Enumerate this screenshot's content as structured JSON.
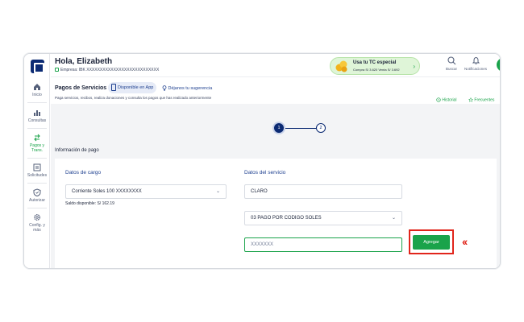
{
  "sidebar": {
    "items": [
      {
        "label": "Inicio",
        "icon": "home-icon"
      },
      {
        "label": "Consultas",
        "icon": "bar-chart-icon"
      },
      {
        "label": "Pagos y Trans.",
        "icon": "transfer-icon",
        "active": true
      },
      {
        "label": "Solicitudes",
        "icon": "list-icon"
      },
      {
        "label": "Autorizar",
        "icon": "shield-icon"
      },
      {
        "label": "Config. y más",
        "icon": "gear-icon"
      }
    ]
  },
  "header": {
    "greeting": "Hola, Elizabeth",
    "company": "Empresa: IBK XXXXXXXXXXXXXXXXXXXXXXXXXXX",
    "promo": {
      "title": "Usa tu TC especial",
      "subtitle": "Compra S/ 3.620   Venta S/ 3.692"
    },
    "search_label": "Buscar",
    "notifications_label": "Notificaciones"
  },
  "subheader": {
    "title": "Pagos de Servicios",
    "app_pill": "Disponible en App",
    "suggestion": "Déjanos tu sugerencia",
    "description": "Paga servicios, recibos, realiza donaciones y consulta los pagos que has realizado anteriormente",
    "history": "Historial",
    "frequent": "Frecuentes"
  },
  "stepper": {
    "step1": "1",
    "step2": "2"
  },
  "form": {
    "section_title": "Información de pago",
    "charge": {
      "title": "Datos de cargo",
      "account": "Corriente Soles 100 XXXXXXXX",
      "balance": "Saldo disponible:  S/ 162.19"
    },
    "service": {
      "title": "Datos del servicio",
      "company": "CLARO",
      "type": "03 PAGO POR CODIGO SOLES",
      "code": "XXXXXXX"
    },
    "add_button": "Agregar"
  },
  "colors": {
    "brand_navy": "#0b2a73",
    "brand_green": "#1aa34a",
    "highlight_red": "#e1251b"
  }
}
